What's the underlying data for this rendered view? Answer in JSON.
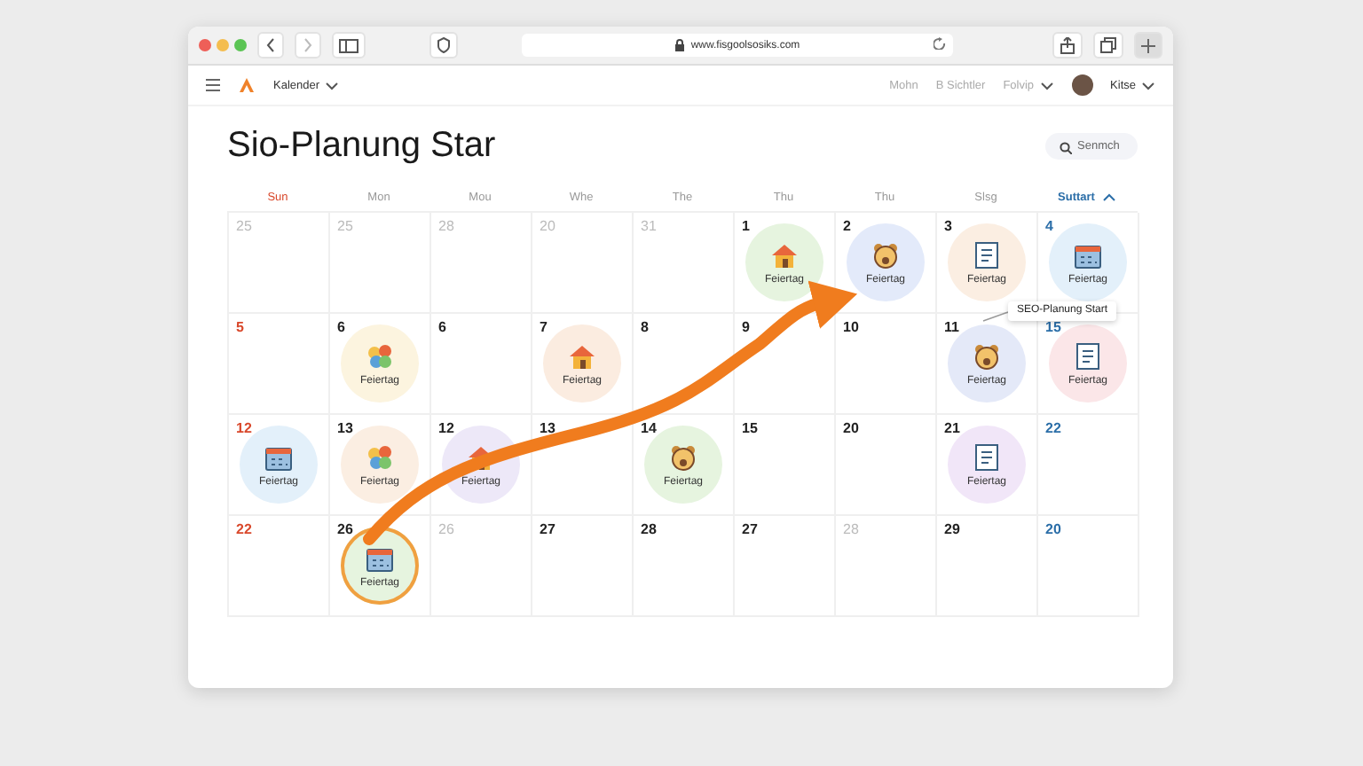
{
  "browser": {
    "url": "www.fisgoolsosiks.com"
  },
  "nav": {
    "menu": "Kalender",
    "links": [
      "Mohn",
      "B Sichtler"
    ],
    "dropdown": "Folvip",
    "user": "Kitse"
  },
  "title": "Sio-Planung Star",
  "search": {
    "placeholder": "Senmch"
  },
  "weekdays": [
    {
      "label": "Sun",
      "kind": "sunday"
    },
    {
      "label": "Mon",
      "kind": "normal"
    },
    {
      "label": "Mou",
      "kind": "normal"
    },
    {
      "label": "Whe",
      "kind": "normal"
    },
    {
      "label": "The",
      "kind": "normal"
    },
    {
      "label": "Thu",
      "kind": "normal"
    },
    {
      "label": "Thu",
      "kind": "normal"
    },
    {
      "label": "Slsg",
      "kind": "normal"
    },
    {
      "label": "Suttart",
      "kind": "action"
    }
  ],
  "weeks": [
    [
      {
        "day": "25",
        "kind": "muted"
      },
      {
        "day": "25",
        "kind": "muted"
      },
      {
        "day": "28",
        "kind": "muted"
      },
      {
        "day": "20",
        "kind": "muted"
      },
      {
        "day": "31",
        "kind": "muted"
      },
      {
        "day": "1",
        "kind": "normal",
        "event": {
          "label": "Feiertag",
          "color": "#e6f4df",
          "highlighted": false
        }
      },
      {
        "day": "2",
        "kind": "normal",
        "event": {
          "label": "Feiertag",
          "color": "#e3eafa",
          "highlighted": false
        }
      },
      {
        "day": "3",
        "kind": "normal",
        "event": {
          "label": "Feiertag",
          "color": "#fbeee2",
          "highlighted": false
        }
      },
      {
        "day": "4",
        "kind": "weekend",
        "event": {
          "label": "Feiertag",
          "color": "#e3f0fa",
          "highlighted": false
        }
      }
    ],
    [
      {
        "day": "5",
        "kind": "sunday"
      },
      {
        "day": "6",
        "kind": "normal",
        "event": {
          "label": "Feiertag",
          "color": "#fcf4df",
          "highlighted": false
        }
      },
      {
        "day": "6",
        "kind": "normal"
      },
      {
        "day": "7",
        "kind": "normal",
        "event": {
          "label": "Feiertag",
          "color": "#fbece0",
          "highlighted": false
        }
      },
      {
        "day": "8",
        "kind": "normal"
      },
      {
        "day": "9",
        "kind": "normal"
      },
      {
        "day": "10",
        "kind": "normal"
      },
      {
        "day": "11",
        "kind": "normal",
        "event": {
          "label": "Feiertag",
          "color": "#e4e9f8",
          "highlighted": false
        }
      },
      {
        "day": "15",
        "kind": "weekend",
        "event": {
          "label": "Feiertag",
          "color": "#fbe6e8",
          "highlighted": false
        }
      }
    ],
    [
      {
        "day": "12",
        "kind": "sunday",
        "event": {
          "label": "Feiertag",
          "color": "#e3f0fa",
          "highlighted": false
        }
      },
      {
        "day": "13",
        "kind": "normal",
        "event": {
          "label": "Feiertag",
          "color": "#fbeee2",
          "highlighted": false
        }
      },
      {
        "day": "12",
        "kind": "normal",
        "event": {
          "label": "Feiertag",
          "color": "#ede8f8",
          "highlighted": false
        }
      },
      {
        "day": "13",
        "kind": "normal"
      },
      {
        "day": "14",
        "kind": "normal",
        "event": {
          "label": "Feiertag",
          "color": "#e6f4df",
          "highlighted": false
        }
      },
      {
        "day": "15",
        "kind": "normal"
      },
      {
        "day": "20",
        "kind": "normal"
      },
      {
        "day": "21",
        "kind": "normal",
        "event": {
          "label": "Feiertag",
          "color": "#f1e6f8",
          "highlighted": false
        }
      },
      {
        "day": "22",
        "kind": "weekend"
      }
    ],
    [
      {
        "day": "22",
        "kind": "sunday"
      },
      {
        "day": "26",
        "kind": "normal",
        "event": {
          "label": "Feiertag",
          "color": "#e6f4df",
          "highlighted": true
        }
      },
      {
        "day": "26",
        "kind": "muted"
      },
      {
        "day": "27",
        "kind": "normal"
      },
      {
        "day": "28",
        "kind": "normal"
      },
      {
        "day": "27",
        "kind": "normal"
      },
      {
        "day": "28",
        "kind": "muted"
      },
      {
        "day": "29",
        "kind": "normal"
      },
      {
        "day": "20",
        "kind": "weekend"
      }
    ]
  ],
  "tooltip": "SEO-Planung Start"
}
